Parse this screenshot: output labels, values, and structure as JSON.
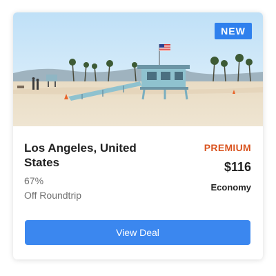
{
  "deal": {
    "badge": "NEW",
    "destination": "Los Angeles, United States",
    "discount_value": "67%",
    "discount_label": "Off Roundtrip",
    "tier": "PREMIUM",
    "price": "$116",
    "cabin": "Economy",
    "cta_label": "View Deal"
  },
  "colors": {
    "accent": "#3b87ef",
    "badge": "#2f80ed",
    "premium": "#d9531e"
  }
}
